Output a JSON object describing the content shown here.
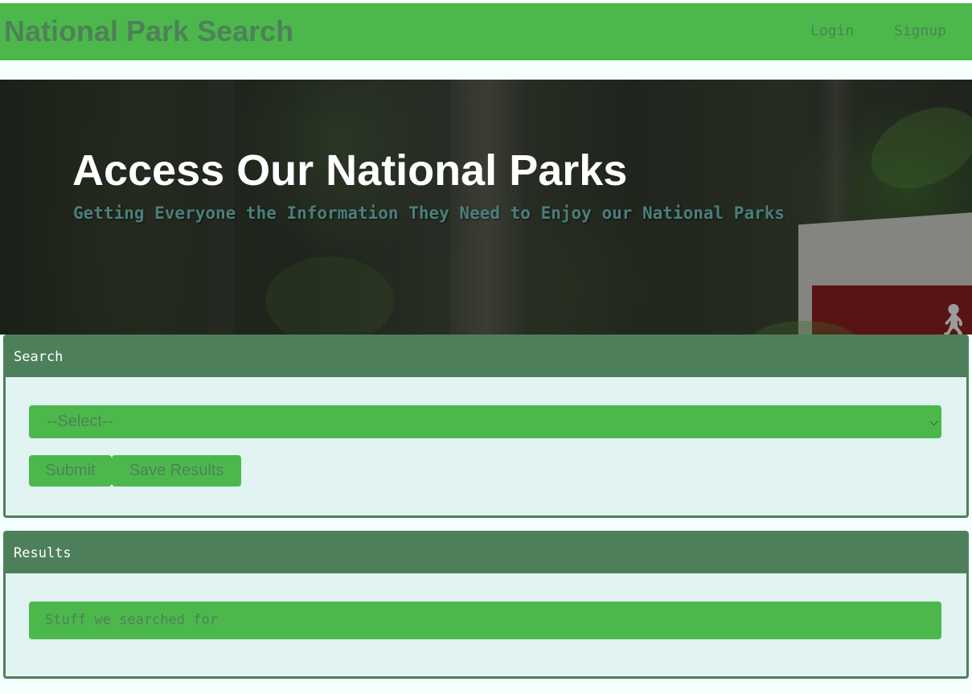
{
  "navbar": {
    "brand": "National Park Search",
    "links": [
      {
        "label": "Login"
      },
      {
        "label": "Signup"
      }
    ]
  },
  "hero": {
    "title": "Access Our National Parks",
    "subtitle": "Getting Everyone the Information They Need to Enjoy our National Parks"
  },
  "search": {
    "header": "Search",
    "select_value": "--Select--",
    "submit_label": "Submit",
    "save_label": "Save Results"
  },
  "results": {
    "header": "Results",
    "content": "Stuff we searched for"
  },
  "colors": {
    "nav_green": "#4cb84c",
    "dark_green": "#4e8159",
    "card_bg": "#e1f4f2",
    "page_bg": "#f5fffd"
  }
}
